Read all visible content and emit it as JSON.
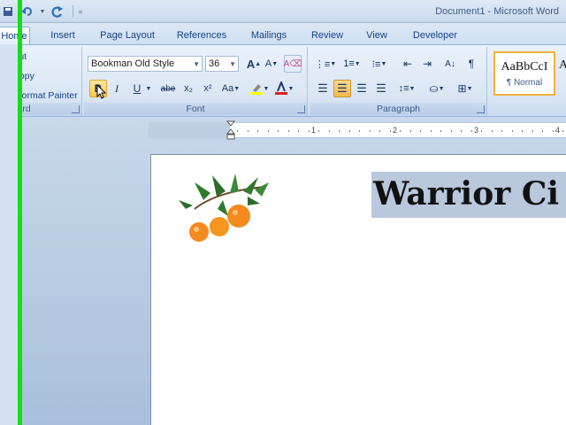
{
  "window": {
    "title": "Document1 - Microsoft Word"
  },
  "tabs": [
    "Home",
    "Insert",
    "Page Layout",
    "References",
    "Mailings",
    "Review",
    "View",
    "Developer"
  ],
  "clipboard": {
    "cut": "Cut",
    "copy": "Copy",
    "format_painter": "Format Painter",
    "label": "pboard"
  },
  "font": {
    "name": "Bookman Old Style",
    "size": "36",
    "label": "Font",
    "bold": "B",
    "italic": "I",
    "underline": "U",
    "strike": "abe",
    "subscript": "x₂",
    "superscript": "x²",
    "change_case": "Aa",
    "grow": "A",
    "shrink": "A"
  },
  "paragraph": {
    "label": "Paragraph"
  },
  "styles": {
    "sample": "AaBbCcI",
    "normal": "¶ Normal",
    "next": "A"
  },
  "ruler": {
    "numbers": [
      "1",
      "1",
      "2",
      "3",
      "4"
    ]
  },
  "document": {
    "heading": "Warrior Ci"
  },
  "colors": {
    "accent": "#15428b",
    "highlight": "#ffc54a",
    "selection": "#b9c8dd",
    "green_bar": "#13e013"
  }
}
